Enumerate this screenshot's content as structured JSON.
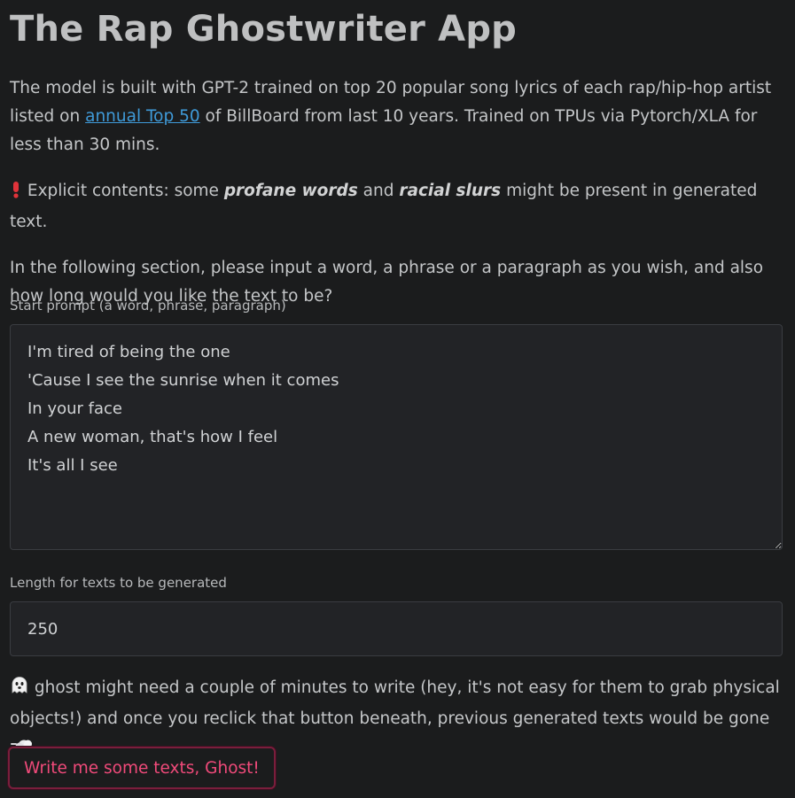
{
  "title": "The Rap Ghostwriter App",
  "intro": {
    "before_link": "The model is built with GPT-2 trained on top 20 popular song lyrics of each rap/hip-hop artist listed on ",
    "link_text": "annual Top 50",
    "after_link": " of BillBoard from last 10 years. Trained on TPUs via Pytorch/XLA for less than 30 mins."
  },
  "explicit": {
    "icon": "exclamation-icon",
    "before": " Explicit contents: some ",
    "term1": "profane words",
    "middle": " and ",
    "term2": "racial slurs",
    "after": " might be present in generated text."
  },
  "instructions": "In the following section, please input a word, a phrase or a paragraph as you wish, and also how long would you like the text to be?",
  "prompt_field": {
    "label": "Start prompt (a word, phrase, paragraph)",
    "value": "I'm tired of being the one\n'Cause I see the sunrise when it comes\nIn your face\nA new woman, that's how I feel\nIt's all I see"
  },
  "length_field": {
    "label": "Length for texts to be generated",
    "value": "250"
  },
  "ghost_note": {
    "icon_start": "ghost-icon",
    "text": " ghost might need a couple of minutes to write (hey, it's not easy for them to grab physical objects!) and once you reclick that button beneath, previous generated texts would be gone ",
    "icon_end": "dash-cloud-icon"
  },
  "button": {
    "label": "Write me some texts, Ghost!"
  },
  "colors": {
    "background": "#1b1c1d",
    "link": "#3f9ad8",
    "button_text": "#f04a7a",
    "button_border": "#7a1e3c"
  }
}
